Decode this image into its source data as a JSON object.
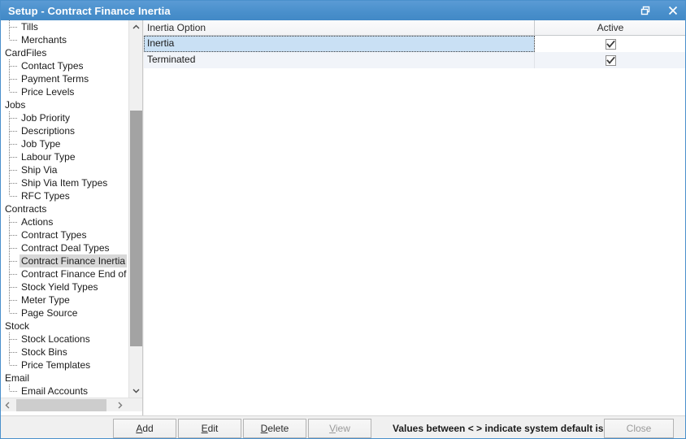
{
  "window": {
    "title": "Setup - Contract Finance Inertia",
    "restore_icon": "restore-icon",
    "close_icon": "close-icon"
  },
  "sidebar": {
    "items": [
      {
        "label": "Tills",
        "type": "child"
      },
      {
        "label": "Merchants",
        "type": "child",
        "last": true
      },
      {
        "label": "CardFiles",
        "type": "group"
      },
      {
        "label": "Contact Types",
        "type": "child"
      },
      {
        "label": "Payment Terms",
        "type": "child"
      },
      {
        "label": "Price Levels",
        "type": "child",
        "last": true
      },
      {
        "label": "Jobs",
        "type": "group"
      },
      {
        "label": "Job Priority",
        "type": "child"
      },
      {
        "label": "Descriptions",
        "type": "child"
      },
      {
        "label": "Job Type",
        "type": "child"
      },
      {
        "label": "Labour Type",
        "type": "child"
      },
      {
        "label": "Ship Via",
        "type": "child"
      },
      {
        "label": "Ship Via Item Types",
        "type": "child"
      },
      {
        "label": "RFC Types",
        "type": "child",
        "last": true
      },
      {
        "label": "Contracts",
        "type": "group"
      },
      {
        "label": "Actions",
        "type": "child"
      },
      {
        "label": "Contract Types",
        "type": "child"
      },
      {
        "label": "Contract Deal Types",
        "type": "child"
      },
      {
        "label": "Contract Finance Inertia",
        "type": "child",
        "selected": true
      },
      {
        "label": "Contract Finance End of Te",
        "type": "child"
      },
      {
        "label": "Stock Yield Types",
        "type": "child"
      },
      {
        "label": "Meter Type",
        "type": "child"
      },
      {
        "label": "Page Source",
        "type": "child",
        "last": true
      },
      {
        "label": "Stock",
        "type": "group"
      },
      {
        "label": "Stock Locations",
        "type": "child"
      },
      {
        "label": "Stock Bins",
        "type": "child"
      },
      {
        "label": "Price Templates",
        "type": "child",
        "last": true
      },
      {
        "label": "Email",
        "type": "group"
      },
      {
        "label": "Email Accounts",
        "type": "child",
        "last": true
      }
    ],
    "scroll_up_icon": "chevron-up-icon",
    "scroll_down_icon": "chevron-down-icon",
    "scroll_left_icon": "chevron-left-icon",
    "scroll_right_icon": "chevron-right-icon"
  },
  "grid": {
    "columns": [
      {
        "label": "Inertia Option",
        "key": "name"
      },
      {
        "label": "Active",
        "key": "active"
      }
    ],
    "rows": [
      {
        "name": "Inertia",
        "active": true,
        "selected": true
      },
      {
        "name": "Terminated",
        "active": true,
        "selected": false
      }
    ],
    "checked_icon": "checkmark-icon"
  },
  "footer": {
    "buttons": [
      {
        "id": "add",
        "label": "Add",
        "accel": "A",
        "disabled": false
      },
      {
        "id": "edit",
        "label": "Edit",
        "accel": "E",
        "disabled": false
      },
      {
        "id": "delete",
        "label": "Delete",
        "accel": "D",
        "disabled": false
      },
      {
        "id": "view",
        "label": "View",
        "accel": "V",
        "disabled": true
      },
      {
        "id": "close",
        "label": "Close",
        "accel": "",
        "disabled": true
      }
    ],
    "status": "Values between < > indicate system default is"
  },
  "colors": {
    "titlebar": "#4a90cc",
    "selection_row": "#c9e0f4",
    "tree_selection": "#d8d8d8",
    "scroll_thumb": "#a3a3a3"
  }
}
